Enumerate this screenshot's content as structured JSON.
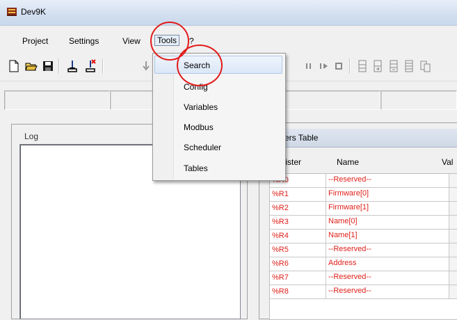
{
  "window": {
    "title": "Dev9K"
  },
  "menubar": {
    "items": [
      {
        "label": "Project"
      },
      {
        "label": "Settings"
      },
      {
        "label": "View"
      },
      {
        "label": "Tools"
      },
      {
        "label": "?"
      }
    ]
  },
  "tools_menu": {
    "items": [
      {
        "label": "Search"
      },
      {
        "label": "Config"
      },
      {
        "label": "Variables"
      },
      {
        "label": "Modbus"
      },
      {
        "label": "Scheduler"
      },
      {
        "label": "Tables"
      }
    ]
  },
  "toolbar": {
    "icons": [
      "new-file-icon",
      "open-folder-icon",
      "save-icon",
      "connect-icon",
      "disconnect-icon",
      "download-icon",
      "pause-icon",
      "step-icon",
      "stop-icon",
      "register-icon-1",
      "register-icon-2",
      "register-icon-3",
      "register-icon-4",
      "register-icon-5"
    ]
  },
  "log": {
    "label": "Log"
  },
  "registers_table": {
    "title": "isters Table",
    "columns": [
      "egister",
      "Name",
      "Val"
    ],
    "rows": [
      {
        "register": "%R0",
        "name": "--Reserved--"
      },
      {
        "register": "%R1",
        "name": "Firmware[0]"
      },
      {
        "register": "%R2",
        "name": "Firmware[1]"
      },
      {
        "register": "%R3",
        "name": "Name[0]"
      },
      {
        "register": "%R4",
        "name": "Name[1]"
      },
      {
        "register": "%R5",
        "name": "--Reserved--"
      },
      {
        "register": "%R6",
        "name": "Address"
      },
      {
        "register": "%R7",
        "name": "--Reserved--"
      },
      {
        "register": "%R8",
        "name": "--Reserved--"
      }
    ]
  },
  "colors": {
    "accent_circle": "#e21a1a",
    "register_text": "#e0201a",
    "menu_highlight": "#dbe7f7"
  }
}
